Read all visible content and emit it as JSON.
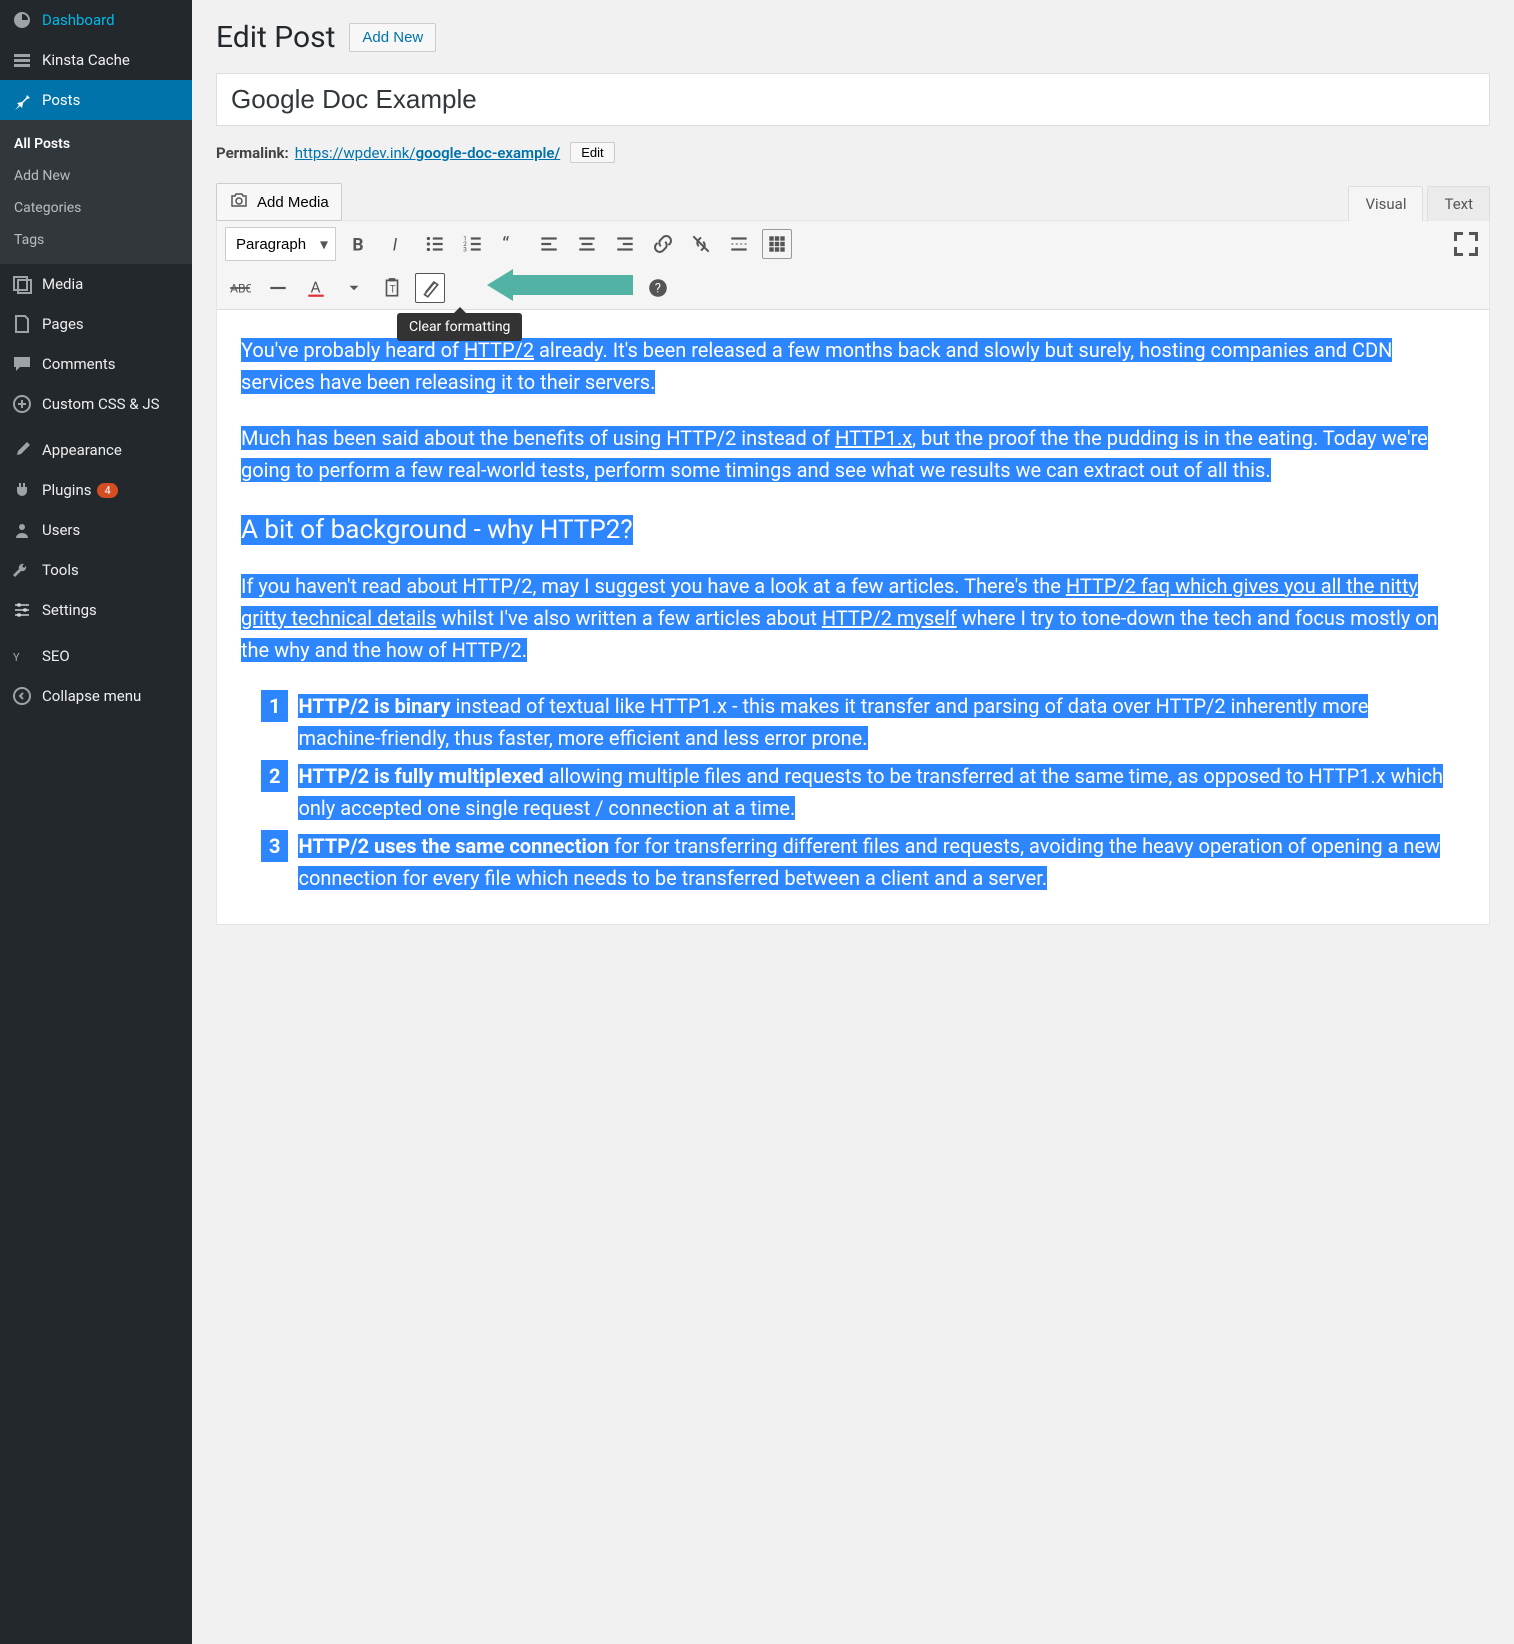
{
  "sidebar": {
    "items": [
      {
        "label": "Dashboard"
      },
      {
        "label": "Kinsta Cache"
      },
      {
        "label": "Posts"
      },
      {
        "label": "Media"
      },
      {
        "label": "Pages"
      },
      {
        "label": "Comments"
      },
      {
        "label": "Custom CSS & JS"
      },
      {
        "label": "Appearance"
      },
      {
        "label": "Plugins"
      },
      {
        "label": "Users"
      },
      {
        "label": "Tools"
      },
      {
        "label": "Settings"
      },
      {
        "label": "SEO"
      },
      {
        "label": "Collapse menu"
      }
    ],
    "submenu": {
      "all_posts": "All Posts",
      "add_new": "Add New",
      "categories": "Categories",
      "tags": "Tags"
    },
    "plugins_badge": "4"
  },
  "header": {
    "title": "Edit Post",
    "add_new": "Add New"
  },
  "post": {
    "title": "Google Doc Example",
    "permalink_label": "Permalink:",
    "permalink_base": "https://wpdev.ink/",
    "permalink_slug": "google-doc-example/",
    "edit_label": "Edit"
  },
  "media_btn": "Add Media",
  "tabs": {
    "visual": "Visual",
    "text": "Text"
  },
  "toolbar": {
    "paragraph": "Paragraph",
    "tooltip": "Clear formatting"
  },
  "content": {
    "p1_a": "You've probably heard of ",
    "p1_link": "HTTP/2",
    "p1_b": " already. It's been released a few months back and slowly but surely, hosting companies and CDN services have been releasing it to their servers.",
    "p2_a": "Much has been said about the benefits of using HTTP/2 instead of ",
    "p2_link": "HTTP1.x",
    "p2_b": ", but the proof the the pudding is in the eating. Today we're going to perform a few real-world tests, perform some timings and see what we results we can extract out of all this.",
    "h2": "A bit of background - why HTTP2?",
    "p3_a": "If you haven't read about HTTP/2, may I suggest you have a look at a few articles. There's the ",
    "p3_link1": "HTTP/2 faq which gives you all the nitty gritty technical details",
    "p3_b": " whilst I've also written a few articles about ",
    "p3_link2": "HTTP/2 myself",
    "p3_c": " where I try to tone-down the tech and focus mostly on the why and the how of HTTP/2.",
    "li1_bold": "HTTP/2 is binary",
    "li1_rest": " instead of textual like HTTP1.x - this makes it transfer and parsing of data over HTTP/2 inherently more machine-friendly, thus faster, more efficient and less error prone.",
    "li2_bold": "HTTP/2 is fully multiplexed",
    "li2_rest": " allowing multiple files and requests to be transferred at the same time, as opposed to HTTP1.x which only accepted one single request / connection at a time.",
    "li3_bold": " HTTP/2 uses the same connection",
    "li3_rest": " for for transferring different files and requests, avoiding the heavy operation of opening a new connection for every file which needs to be transferred between a client and a server.",
    "n1": "1",
    "n2": "2",
    "n3": "3"
  }
}
